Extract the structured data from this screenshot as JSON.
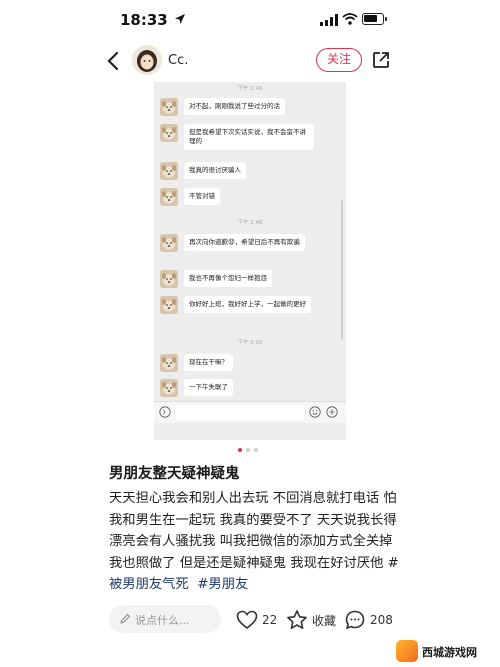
{
  "status_bar": {
    "time": "18:33",
    "battery_level": 0.8
  },
  "header": {
    "author_name": "Cc.",
    "follow_label": "关注"
  },
  "chat": {
    "groups": [
      {
        "time": "下午 2:46"
      },
      {
        "time": "下午 2:48"
      },
      {
        "time": "下午 5:00"
      }
    ],
    "messages": [
      "对不起，刚刚我说了些过分的话",
      "但是我希望下次实话实说，我不会蛮不讲理的",
      "我真的很讨厌骗人",
      "不管对错",
      "再次向你道歉😧，希望日后不再有欺骗",
      "我也不再像个怨妇一样抱怨",
      "你好好上班，我好好上学，一起做的更好",
      "现在在干嘛？",
      "一下午失联了"
    ]
  },
  "carousel": {
    "total": 3,
    "active": 1
  },
  "note": {
    "title": "男朋友整天疑神疑鬼",
    "lines": [
      "天天担心我会和别人出去玩 不回消息就打电话 怕",
      "我和男生在一起玩 我真的要受不了 天天说我长得",
      "漂亮会有人骚扰我 叫我把微信的添加方式全关掉",
      "我也照做了 但是还是疑神疑鬼 我现在好讨厌他 #"
    ],
    "hashtags": [
      "被男朋友气死",
      "#男朋友"
    ]
  },
  "bottom_bar": {
    "comment_placeholder": "说点什么...",
    "like_count": "22",
    "collect_label": "收藏",
    "comment_count": "208"
  },
  "watermark": {
    "text": "西城游戏网"
  },
  "colors": {
    "accent": "#e3314e",
    "chat_bg": "#ededed",
    "hashtag": "#1f3a6e"
  }
}
